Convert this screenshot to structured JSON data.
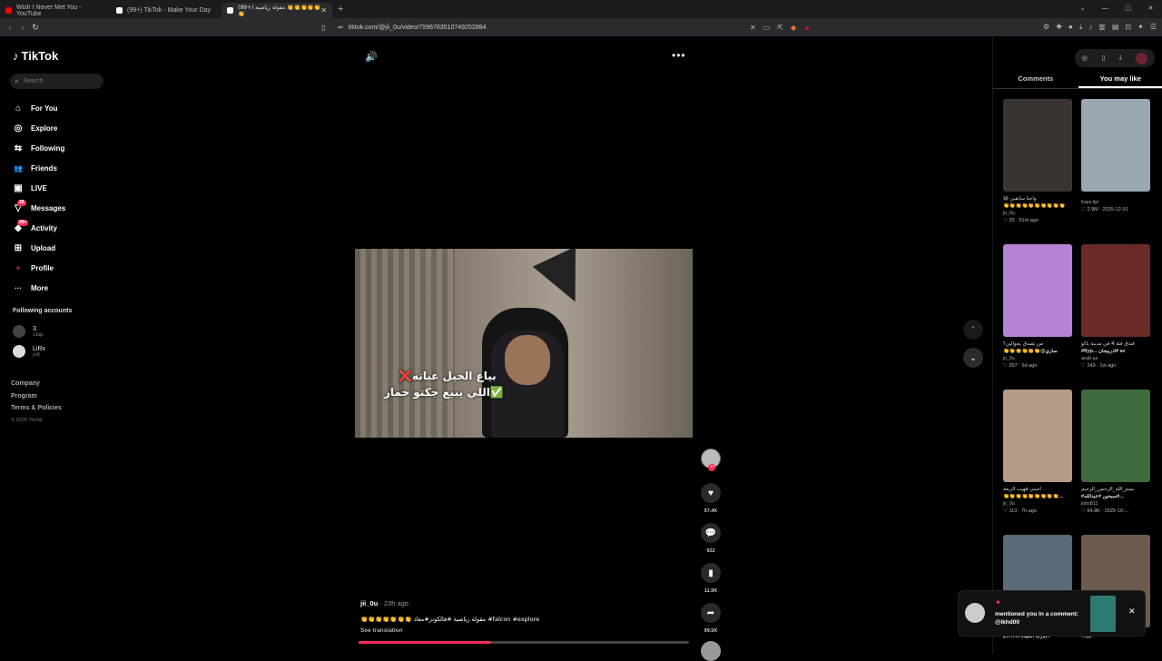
{
  "browser": {
    "tabs": [
      {
        "title": "Wish I Never Met You - YouTube",
        "color": "#ff0000"
      },
      {
        "title": "(99+) TikTok - Make Your Day",
        "color": "#ffffff"
      },
      {
        "title": "(99+) مقولة رياضية 👏👏👏👏👏👏",
        "color": "#ffffff"
      }
    ],
    "new_tab": "+",
    "url": "tiktok.com/@jii_0u/video/7596783510749252884"
  },
  "sidebar": {
    "logo": "TikTok",
    "search_placeholder": "Search",
    "items": [
      {
        "label": "For You",
        "icon": "⌂"
      },
      {
        "label": "Explore",
        "icon": "◎"
      },
      {
        "label": "Following",
        "icon": "⇆"
      },
      {
        "label": "Friends",
        "icon": "👥"
      },
      {
        "label": "LIVE",
        "icon": "▣"
      },
      {
        "label": "Messages",
        "icon": "▽",
        "badge": "28"
      },
      {
        "label": "Activity",
        "icon": "◆",
        "badge": "99+"
      },
      {
        "label": "Upload",
        "icon": "⊞"
      },
      {
        "label": "Profile",
        "icon": "●"
      },
      {
        "label": "More",
        "icon": "···"
      }
    ],
    "following_header": "Following accounts",
    "following": [
      {
        "name": "3",
        "sub": "c3ajs"
      },
      {
        "name": "LiRx",
        "sub": "yx8"
      }
    ],
    "footer": [
      "Company",
      "Program",
      "Terms & Policies"
    ],
    "copyright": "© 2026 TikTok"
  },
  "video": {
    "caption_line1": "بياع الخيل عباته❌",
    "caption_line2": "✅اللي يبيع جكتو حمار",
    "author": "jii_0u",
    "time": " · 23h ago",
    "description": "👏👏👏👏👏👏👏 مقولة رياضية #فالكونز#معاذ #falcon #explore",
    "see_translation": "See translation",
    "progress": 0.4,
    "likes": "57.4K",
    "comments": "922",
    "saves": "11.9K",
    "shares": "99.5K"
  },
  "right_panel": {
    "tab_comments": "Comments",
    "tab_you_may_like": "You may like",
    "cards": [
      {
        "caption": "واحنا سايقين 😄",
        "caption2": "👏👏👏👏👏👏👏👏👏👏",
        "user": "jii_0u",
        "stats": "♡ 20 · 51m ago",
        "thumb": "#3a3430"
      },
      {
        "caption": "",
        "caption2": "",
        "user": "liops.lipi",
        "stats": "♡ 2.9M · 2025-12-31",
        "thumb": "#9aa8b4"
      },
      {
        "caption": "من تصدق بجوالين؟",
        "caption2": "👏👏👏👏👏👏@ساري",
        "user": "jii_0u",
        "stats": "♡ 207 · 5d ago",
        "thumb": "#b783d6"
      },
      {
        "caption": "فندق فئة 4 في مدينة باكو",
        "caption2": "#flyp... اذربيجان# az",
        "user": "arab.az",
        "stats": "♡ 249 · 1w ago",
        "thumb": "#6a2a28"
      },
      {
        "caption": "احبني قهيت الربعة",
        "caption2": "👏👏👏👏👏👏👏👏👏...",
        "user": "jii_0u",
        "stats": "♡ 113 · 7h ago",
        "thumb": "#b59a85"
      },
      {
        "caption": "بسم_الله_الرحمن_الرحيم",
        "caption2": "#سبحين #عبدالله#...",
        "user": "jolio811",
        "stats": "♡ 64.8K · 2025-10-...",
        "thumb": "#3f6a3d"
      },
      {
        "caption": "",
        "caption2": "perfect يارب الجيدة...",
        "user": "",
        "stats": "",
        "thumb": "#5a6a78"
      },
      {
        "caption": "",
        "caption2": "#fyp",
        "user": "",
        "stats": "",
        "thumb": "#6d5c4e"
      }
    ]
  },
  "notification": {
    "text": "mentioned you in a comment: @ikhd00",
    "close": "✕"
  }
}
